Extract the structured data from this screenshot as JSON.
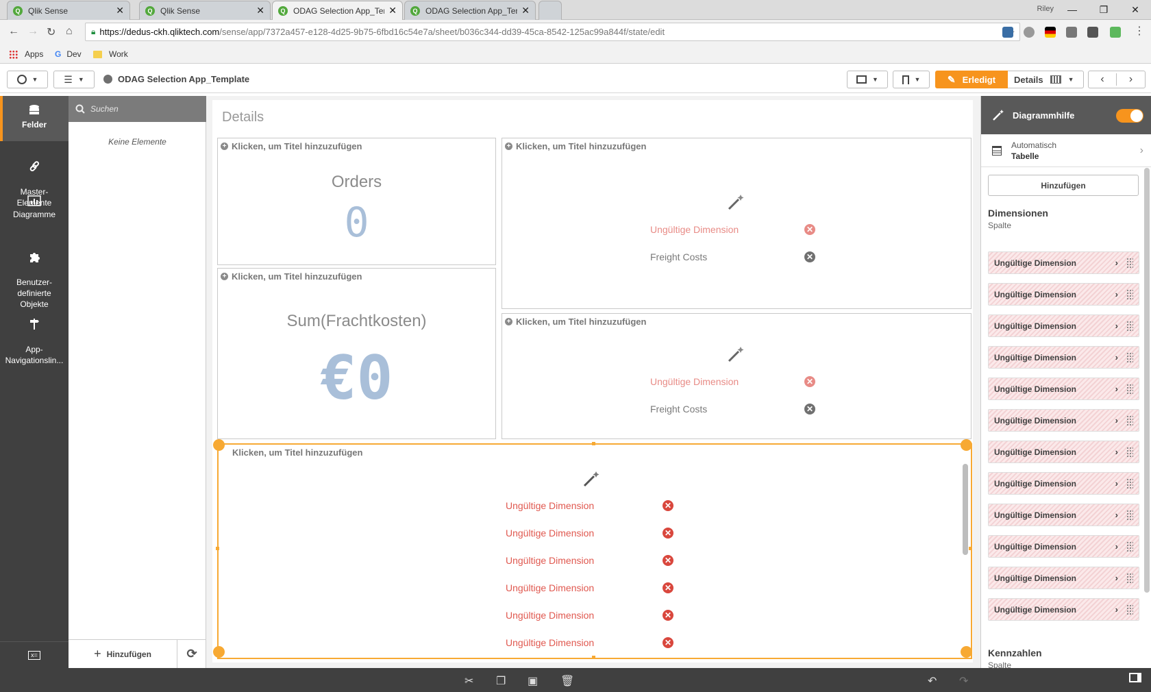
{
  "browser": {
    "tabs": [
      {
        "title": "Qlik Sense",
        "active": false
      },
      {
        "title": "Qlik Sense",
        "active": false
      },
      {
        "title": "ODAG Selection App_Tem",
        "active": true
      },
      {
        "title": "ODAG Selection App_Ten",
        "active": false
      }
    ],
    "user": "Riley",
    "url_host": "https://dedus-ckh.qliktech.com",
    "url_path": "/sense/app/7372a457-e128-4d25-9b75-6fbd16c54e7a/sheet/b036c344-dd39-45ca-8542-125ac99a844f/state/edit",
    "bookmarks": [
      "Apps",
      "Dev",
      "Work"
    ]
  },
  "toolbar": {
    "app_title": "ODAG Selection App_Template",
    "done_label": "Erledigt",
    "details_label": "Details"
  },
  "leftnav": {
    "items": [
      {
        "label": "Felder",
        "icon": "database-icon"
      },
      {
        "label": "Master-\nElemente",
        "icon": "link-icon"
      },
      {
        "label": "Diagramme",
        "icon": "bar-chart-icon"
      },
      {
        "label": "Benutzer-\ndefinierte\nObjekte",
        "icon": "puzzle-icon"
      },
      {
        "label": "App-\nNavigationslin...",
        "icon": "signpost-icon"
      }
    ]
  },
  "fieldpanel": {
    "search_placeholder": "Suchen",
    "empty_text": "Keine Elemente",
    "add_label": "Hinzufügen"
  },
  "sheet": {
    "title": "Details",
    "placeholder_title": "Klicken, um Titel hinzuzufügen",
    "kpi1": {
      "label": "Orders",
      "value": "0"
    },
    "kpi2": {
      "label": "Sum(Frachtkosten)",
      "value": "€0"
    },
    "invalid_dimension": "Ungültige Dimension",
    "freight_costs": "Freight Costs"
  },
  "rightpanel": {
    "header": "Diagrammhilfe",
    "toggle_on": true,
    "viz_mode": "Automatisch",
    "viz_type": "Tabelle",
    "add_label": "Hinzufügen",
    "dimensions_title": "Dimensionen",
    "dimensions_sub": "Spalte",
    "dimension_items": [
      "Ungültige Dimension",
      "Ungültige Dimension",
      "Ungültige Dimension",
      "Ungültige Dimension",
      "Ungültige Dimension",
      "Ungültige Dimension",
      "Ungültige Dimension",
      "Ungültige Dimension",
      "Ungültige Dimension",
      "Ungültige Dimension",
      "Ungültige Dimension",
      "Ungültige Dimension"
    ],
    "measures_title": "Kennzahlen",
    "measures_sub": "Spalte"
  },
  "colors": {
    "accent": "#f7941d",
    "selected_border": "#f7a933",
    "error": "#d9473d",
    "kpi_value": "#a9bfd9",
    "sidebar": "#404040"
  }
}
